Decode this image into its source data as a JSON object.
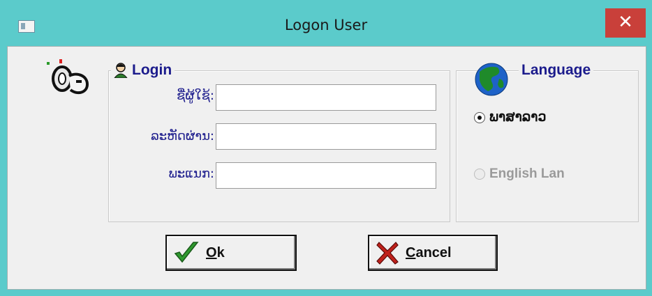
{
  "window": {
    "title": "Logon User",
    "close_glyph": "✕"
  },
  "login_group": {
    "legend": "Login",
    "fields": [
      {
        "label": "ຊື່ຜູ້ໃຊ້:",
        "value": "",
        "placeholder": ""
      },
      {
        "label": "ລະຫັດຜ່ານ:",
        "value": "",
        "placeholder": ""
      },
      {
        "label": "ພະແນກ:",
        "value": "",
        "placeholder": ""
      }
    ]
  },
  "language_group": {
    "legend": "Language",
    "options": [
      {
        "label": "ພາສາລາວ",
        "selected": true,
        "enabled": true
      },
      {
        "label": "English Lan",
        "selected": false,
        "enabled": false
      }
    ]
  },
  "buttons": {
    "ok": {
      "first": "O",
      "rest": "k"
    },
    "cancel": {
      "first": "C",
      "rest": "ancel"
    }
  },
  "icons": {
    "app": "app-window-icon",
    "close": "close-icon",
    "key": "key-icon",
    "person": "person-icon",
    "globe": "globe-icon",
    "checkmark": "checkmark-icon",
    "cross": "cross-icon"
  },
  "colors": {
    "titlebar": "#5bcbcb",
    "close": "#c9403a",
    "legend_text": "#1b1b8c",
    "dialog_bg": "#f0f0f0"
  }
}
